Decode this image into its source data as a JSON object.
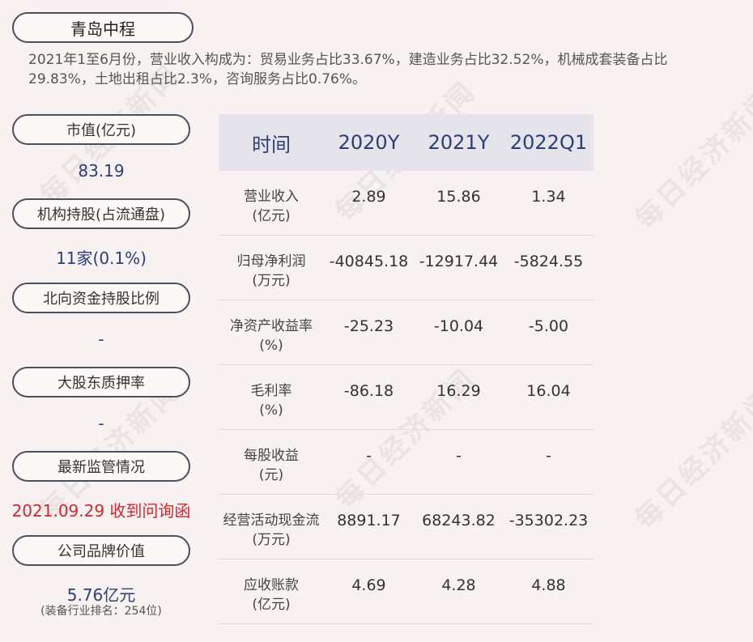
{
  "company": {
    "name": "青岛中程"
  },
  "summary": "2021年1至6月份，营业收入构成为：贸易业务占比33.67%，建造业务占比32.52%，机械成套装备占比29.83%，土地出租占比2.3%，咨询服务占比0.76%。",
  "sidebar": [
    {
      "label": "市值(亿元)",
      "value": "83.19"
    },
    {
      "label": "机构持股(占流通盘)",
      "value": "11家(0.1%)"
    },
    {
      "label": "北向资金持股比例",
      "value": "-"
    },
    {
      "label": "大股东质押率",
      "value": "-"
    },
    {
      "label": "最新监管情况",
      "value": "2021.09.29 收到问询函"
    },
    {
      "label": "公司品牌价值",
      "value": "5.76亿元",
      "sub": "(装备行业排名：254位)"
    }
  ],
  "table": {
    "headers": [
      "时间",
      "2020Y",
      "2021Y",
      "2022Q1"
    ],
    "rows": [
      {
        "name": "营业收入",
        "unit": "(亿元)",
        "values": [
          "2.89",
          "15.86",
          "1.34"
        ]
      },
      {
        "name": "归母净利润",
        "unit": "(万元)",
        "values": [
          "-40845.18",
          "-12917.44",
          "-5824.55"
        ]
      },
      {
        "name": "净资产收益率",
        "unit": "(%)",
        "values": [
          "-25.23",
          "-10.04",
          "-5.00"
        ]
      },
      {
        "name": "毛利率",
        "unit": "(%)",
        "values": [
          "-86.18",
          "16.29",
          "16.04"
        ]
      },
      {
        "name": "每股收益",
        "unit": "(元)",
        "values": [
          "-",
          "-",
          "-"
        ]
      },
      {
        "name": "经营活动现金流",
        "unit": "(万元)",
        "values": [
          "8891.17",
          "68243.82",
          "-35302.23"
        ]
      },
      {
        "name": "应收账款",
        "unit": "(亿元)",
        "values": [
          "4.69",
          "4.28",
          "4.88"
        ]
      }
    ]
  },
  "watermark": "每日经济新闻",
  "colors": {
    "accent": "#2c3e78",
    "alert": "#d6262b",
    "background": "#f7f2f1",
    "header_bg": "#e5e4ea"
  }
}
